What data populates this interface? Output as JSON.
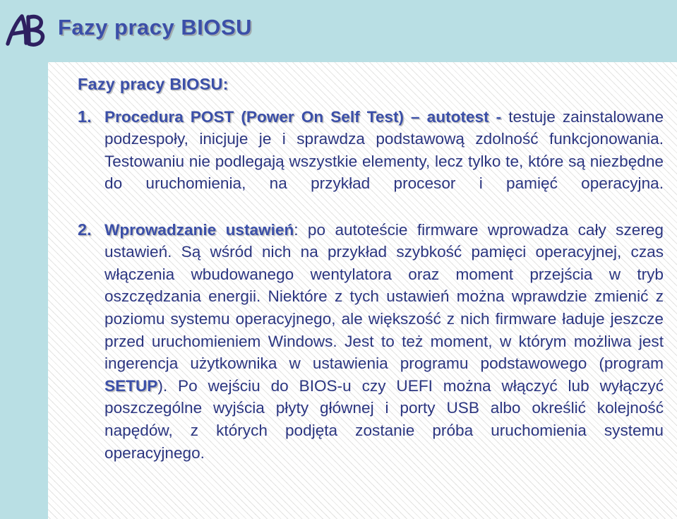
{
  "slide": {
    "title": "Fazy pracy BIOSU",
    "logo_text": "AB",
    "accent_color": "#b9dfe4",
    "heading_color": "#3b4fa8",
    "body_color": "#2b3580",
    "panel_color": "#f2f2f0"
  },
  "body": {
    "heading": "Fazy pracy BIOSU:",
    "items": [
      {
        "number": "1.",
        "lead": "Procedura POST (Power On Self Test) – autotest -",
        "text": " testuje zainstalowane podzespoły, inicjuje je i sprawdza podstawową zdolność funkcjonowania. Testowaniu nie podlegają wszystkie elementy, lecz tylko te, które są niezbędne do uruchomienia, na przykład procesor i pamięć operacyjna."
      },
      {
        "number": "2.",
        "lead": "Wprowadzanie ustawień",
        "text_part1": ": po autoteście firmware wprowadza cały szereg ustawień. Są wśród nich na przykład szybkość pamięci operacyjnej, czas włączenia wbudowanego wentylatora oraz moment przejścia w tryb oszczędzania energii. Niektóre z tych ustawień można wprawdzie zmienić z poziomu systemu operacyjnego, ale większość z nich firmware ładuje jeszcze przed uruchomieniem Windows. Jest to też moment, w którym możliwa jest ingerencja użytkownika w ustawienia programu podstawowego (program ",
        "emphasis": "SETUP",
        "text_part2": "). Po wejściu do BIOS-u czy UEFI można włączyć lub wyłączyć poszczególne wyjścia płyty głównej i porty USB albo określić kolejność napędów, z których podjęta zostanie próba uruchomienia systemu operacyjnego."
      }
    ]
  }
}
